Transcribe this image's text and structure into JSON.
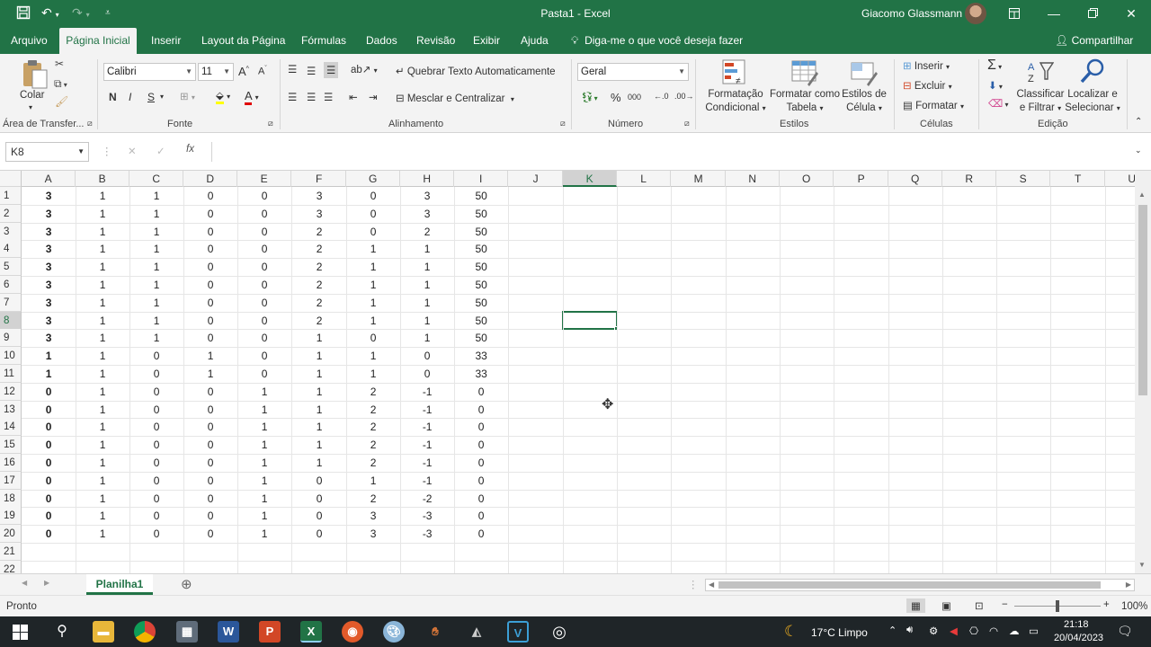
{
  "window": {
    "title": "Pasta1  -  Excel",
    "user": "Giacomo Glassmann"
  },
  "tabs": [
    "Arquivo",
    "Página Inicial",
    "Inserir",
    "Layout da Página",
    "Fórmulas",
    "Dados",
    "Revisão",
    "Exibir",
    "Ajuda"
  ],
  "tell_me": "Diga-me o que você deseja fazer",
  "share": "Compartilhar",
  "ribbon": {
    "clipboard": {
      "paste": "Colar",
      "group": "Área de Transfer..."
    },
    "font": {
      "name": "Calibri",
      "size": "11",
      "group": "Fonte",
      "bold": "N",
      "italic": "I",
      "underline": "S"
    },
    "alignment": {
      "wrap": "Quebrar Texto Automaticamente",
      "merge": "Mesclar e Centralizar",
      "group": "Alinhamento"
    },
    "number": {
      "format": "Geral",
      "group": "Número",
      "percent": "%",
      "thousands": "000"
    },
    "styles": {
      "conditional": [
        "Formatação",
        "Condicional"
      ],
      "table": [
        "Formatar como",
        "Tabela"
      ],
      "cell": [
        "Estilos de",
        "Célula"
      ],
      "group": "Estilos"
    },
    "cells": {
      "insert": "Inserir",
      "delete": "Excluir",
      "format": "Formatar",
      "group": "Células"
    },
    "editing": {
      "sort": [
        "Classificar",
        "e Filtrar"
      ],
      "find": [
        "Localizar e",
        "Selecionar"
      ],
      "group": "Edição"
    }
  },
  "name_box": "K8",
  "fx": "fx",
  "columns": [
    "A",
    "B",
    "C",
    "D",
    "E",
    "F",
    "G",
    "H",
    "I",
    "J",
    "K",
    "L",
    "M",
    "N",
    "O",
    "P",
    "Q",
    "R",
    "S",
    "T",
    "U"
  ],
  "selected_column": "K",
  "selected_row": "8",
  "rows": [
    [
      "3",
      "1",
      "1",
      "0",
      "0",
      "3",
      "0",
      "3",
      "50"
    ],
    [
      "3",
      "1",
      "1",
      "0",
      "0",
      "3",
      "0",
      "3",
      "50"
    ],
    [
      "3",
      "1",
      "1",
      "0",
      "0",
      "2",
      "0",
      "2",
      "50"
    ],
    [
      "3",
      "1",
      "1",
      "0",
      "0",
      "2",
      "1",
      "1",
      "50"
    ],
    [
      "3",
      "1",
      "1",
      "0",
      "0",
      "2",
      "1",
      "1",
      "50"
    ],
    [
      "3",
      "1",
      "1",
      "0",
      "0",
      "2",
      "1",
      "1",
      "50"
    ],
    [
      "3",
      "1",
      "1",
      "0",
      "0",
      "2",
      "1",
      "1",
      "50"
    ],
    [
      "3",
      "1",
      "1",
      "0",
      "0",
      "2",
      "1",
      "1",
      "50"
    ],
    [
      "3",
      "1",
      "1",
      "0",
      "0",
      "1",
      "0",
      "1",
      "50"
    ],
    [
      "1",
      "1",
      "0",
      "1",
      "0",
      "1",
      "1",
      "0",
      "33"
    ],
    [
      "1",
      "1",
      "0",
      "1",
      "0",
      "1",
      "1",
      "0",
      "33"
    ],
    [
      "0",
      "1",
      "0",
      "0",
      "1",
      "1",
      "2",
      "-1",
      "0"
    ],
    [
      "0",
      "1",
      "0",
      "0",
      "1",
      "1",
      "2",
      "-1",
      "0"
    ],
    [
      "0",
      "1",
      "0",
      "0",
      "1",
      "1",
      "2",
      "-1",
      "0"
    ],
    [
      "0",
      "1",
      "0",
      "0",
      "1",
      "1",
      "2",
      "-1",
      "0"
    ],
    [
      "0",
      "1",
      "0",
      "0",
      "1",
      "1",
      "2",
      "-1",
      "0"
    ],
    [
      "0",
      "1",
      "0",
      "0",
      "1",
      "0",
      "1",
      "-1",
      "0"
    ],
    [
      "0",
      "1",
      "0",
      "0",
      "1",
      "0",
      "2",
      "-2",
      "0"
    ],
    [
      "0",
      "1",
      "0",
      "0",
      "1",
      "0",
      "3",
      "-3",
      "0"
    ],
    [
      "0",
      "1",
      "0",
      "0",
      "1",
      "0",
      "3",
      "-3",
      "0"
    ]
  ],
  "row_numbers": [
    "1",
    "2",
    "3",
    "4",
    "5",
    "6",
    "7",
    "8",
    "9",
    "10",
    "11",
    "12",
    "13",
    "14",
    "15",
    "16",
    "17",
    "18",
    "19",
    "20",
    "21",
    "22"
  ],
  "sheet": {
    "name": "Planilha1"
  },
  "status": {
    "mode": "Pronto",
    "zoom": "100%"
  },
  "taskbar": {
    "weather": "17°C  Limpo",
    "time": "21:18",
    "date": "20/04/2023"
  }
}
